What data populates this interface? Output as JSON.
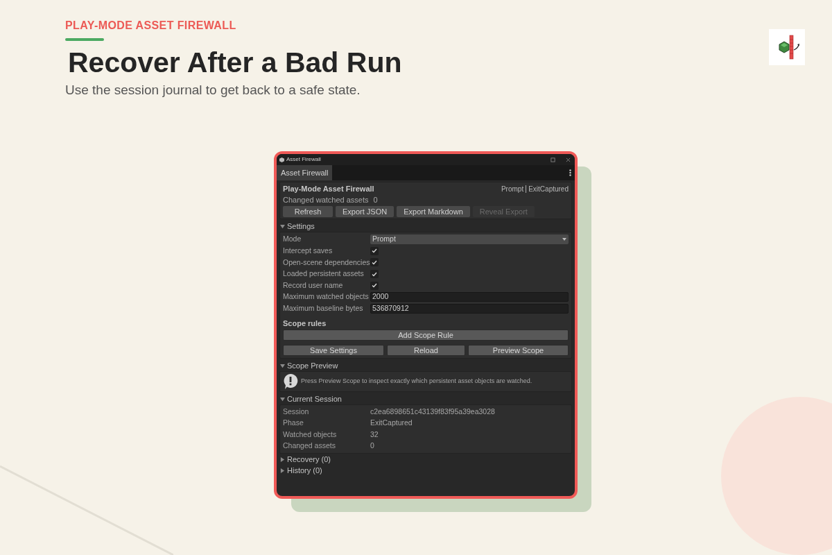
{
  "slide": {
    "eyebrow": "PLAY-MODE ASSET FIREWALL",
    "title": "Recover After a Bad Run",
    "subtitle": "Use the session journal to get back to a safe state."
  },
  "window": {
    "title": "Asset Firewall",
    "tabs": [
      {
        "label": "Asset Firewall",
        "selected": true
      }
    ],
    "header": {
      "title": "Play-Mode Asset Firewall",
      "mode": "Prompt",
      "phase": "ExitCaptured",
      "changed_label": "Changed watched assets",
      "changed_value": "0",
      "buttons": [
        {
          "label": "Refresh",
          "disabled": false
        },
        {
          "label": "Export JSON",
          "disabled": false
        },
        {
          "label": "Export Markdown",
          "disabled": false
        },
        {
          "label": "Reveal Export",
          "disabled": true
        }
      ]
    },
    "settings": {
      "heading": "Settings",
      "expanded": true,
      "fields": [
        {
          "kind": "dropdown",
          "label": "Mode",
          "value": "Prompt"
        },
        {
          "kind": "checkbox",
          "label": "Intercept saves",
          "checked": true
        },
        {
          "kind": "checkbox",
          "label": "Open-scene dependencies",
          "checked": true
        },
        {
          "kind": "checkbox",
          "label": "Loaded persistent assets",
          "checked": true
        },
        {
          "kind": "checkbox",
          "label": "Record user name",
          "checked": true
        },
        {
          "kind": "number",
          "label": "Maximum watched objects",
          "value": "2000"
        },
        {
          "kind": "number",
          "label": "Maximum baseline bytes",
          "value": "536870912"
        }
      ],
      "scope_rules_heading": "Scope rules",
      "add_rule_button": "Add Scope Rule",
      "buttons": [
        "Save Settings",
        "Reload",
        "Preview Scope"
      ]
    },
    "scope_preview": {
      "heading": "Scope Preview",
      "expanded": true,
      "message": "Press Preview Scope to inspect exactly which persistent asset objects are watched."
    },
    "current_session": {
      "heading": "Current Session",
      "expanded": true,
      "rows": [
        {
          "label": "Session",
          "value": "c2ea6898651c43139f83f95a39ea3028"
        },
        {
          "label": "Phase",
          "value": "ExitCaptured"
        },
        {
          "label": "Watched objects",
          "value": "32"
        },
        {
          "label": "Changed assets",
          "value": "0"
        }
      ]
    },
    "foldouts": [
      {
        "heading": "Recovery (0)",
        "expanded": false
      },
      {
        "heading": "History (0)",
        "expanded": false
      }
    ]
  }
}
